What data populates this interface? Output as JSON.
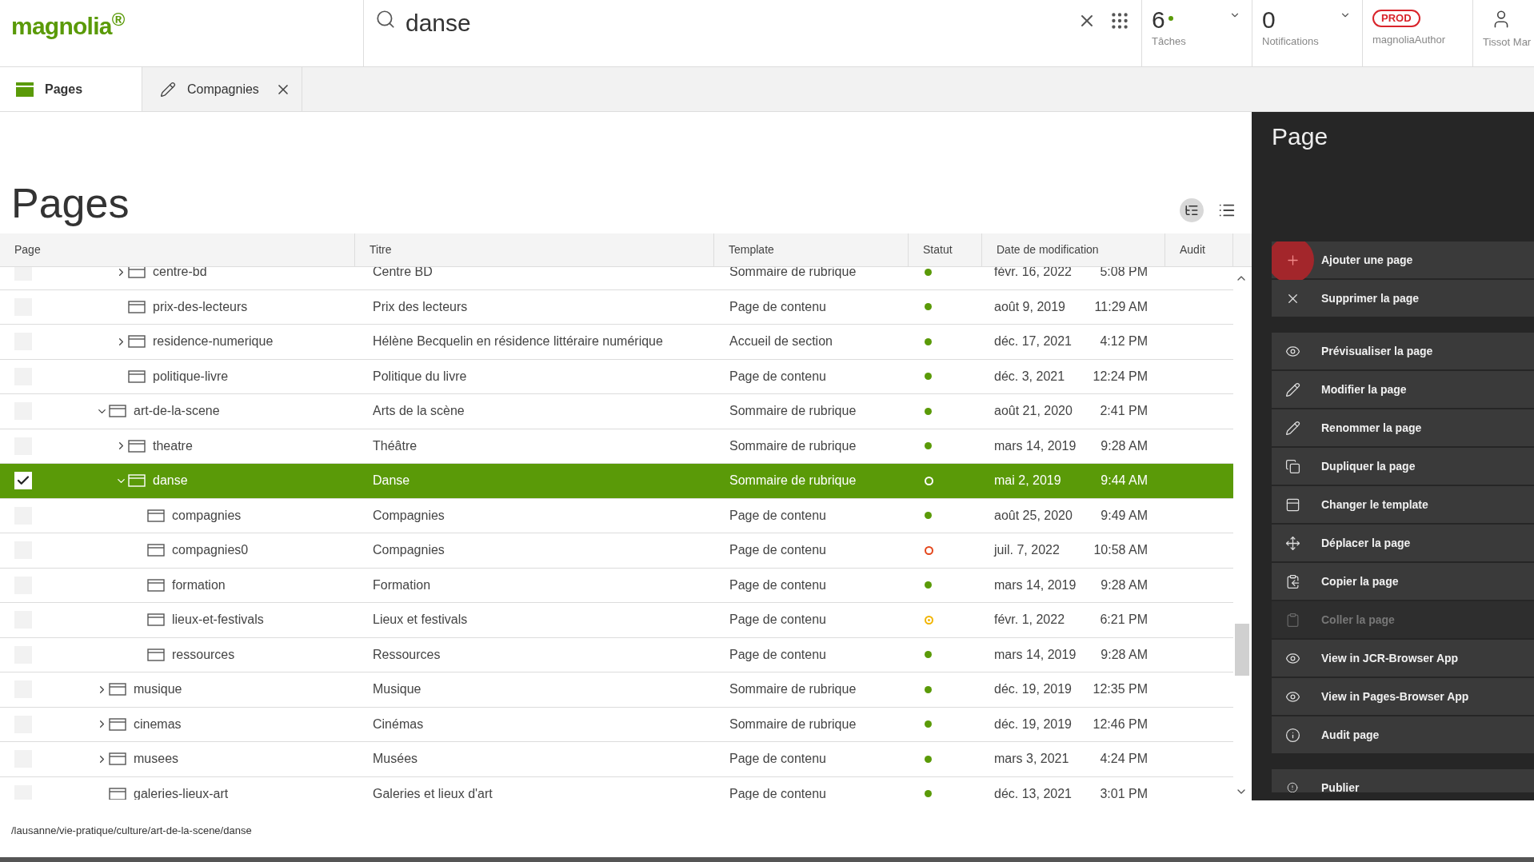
{
  "header": {
    "logo": "magnolia$^{®}$",
    "search": {
      "value": "danse"
    },
    "tasks": {
      "count": "6",
      "label": "Tâches"
    },
    "notifications": {
      "count": "0",
      "label": "Notifications"
    },
    "environment": {
      "badge": "PROD",
      "user_role": "magnoliaAuthor"
    },
    "user": {
      "name": "Tissot Mar"
    }
  },
  "tabs": [
    {
      "label": "Pages",
      "kind": "app",
      "selected": true
    },
    {
      "label": "Compagnies",
      "kind": "editor",
      "selected": false
    }
  ],
  "title": "Pages",
  "table": {
    "columns": [
      "Page",
      "Titre",
      "Template",
      "Statut",
      "Date de modification",
      "Audit"
    ],
    "rows": [
      {
        "children": [
          {
            "page": "centre-bd",
            "title": "Centre BD",
            "template": "Sommaire de rubrique",
            "status": {
              "kind": "dot",
              "color": "#5a9a08"
            },
            "date": "févr. 16, 2022",
            "time": "5:08 PM",
            "expanded": false,
            "selected": false
          },
          {
            "page": "prix-des-lecteurs",
            "title": "Prix des lecteurs",
            "template": "Page de contenu",
            "status": {
              "kind": "dot",
              "color": "#5a9a08"
            },
            "date": "août 9, 2019",
            "time": "11:29 AM",
            "selected": false
          },
          {
            "page": "residence-numerique",
            "title": "Hélène Becquelin en résidence littéraire numérique",
            "template": "Accueil de section",
            "status": {
              "kind": "dot",
              "color": "#5a9a08"
            },
            "date": "déc. 17, 2021",
            "time": "4:12 PM",
            "expanded": false,
            "selected": false
          },
          {
            "page": "politique-livre",
            "title": "Politique du livre",
            "template": "Page de contenu",
            "status": {
              "kind": "dot",
              "color": "#5a9a08"
            },
            "date": "déc. 3, 2021",
            "time": "12:24 PM",
            "selected": false
          }
        ]
      },
      {
        "page": "art-de-la-scene",
        "title": "Arts de la scène",
        "template": "Sommaire de rubrique",
        "status": {
          "kind": "dot",
          "color": "#5a9a08"
        },
        "date": "août 21, 2020",
        "time": "2:41 PM",
        "expanded": true,
        "selected": false,
        "children": [
          {
            "page": "theatre",
            "title": "Théâtre",
            "template": "Sommaire de rubrique",
            "status": {
              "kind": "dot",
              "color": "#5a9a08"
            },
            "date": "mars 14, 2019",
            "time": "9:28 AM",
            "expanded": false,
            "selected": false
          },
          {
            "page": "danse",
            "title": "Danse",
            "template": "Sommaire de rubrique",
            "status": {
              "kind": "ring",
              "color": "#ffffff"
            },
            "date": "mai 2, 2019",
            "time": "9:44 AM",
            "expanded": true,
            "selected": true,
            "children": [
              {
                "page": "compagnies",
                "title": "Compagnies",
                "template": "Page de contenu",
                "status": {
                  "kind": "dot",
                  "color": "#5a9a08"
                },
                "date": "août 25, 2020",
                "time": "9:49 AM",
                "selected": false
              },
              {
                "page": "compagnies0",
                "title": "Compagnies",
                "template": "Page de contenu",
                "status": {
                  "kind": "ring",
                  "color": "#e4461b"
                },
                "date": "juil. 7, 2022",
                "time": "10:58 AM",
                "selected": false
              },
              {
                "page": "formation",
                "title": "Formation",
                "template": "Page de contenu",
                "status": {
                  "kind": "dot",
                  "color": "#5a9a08"
                },
                "date": "mars 14, 2019",
                "time": "9:28 AM",
                "selected": false
              },
              {
                "page": "lieux-et-festivals",
                "title": "Lieux et festivals",
                "template": "Page de contenu",
                "status": {
                  "kind": "ring-dot",
                  "color": "#f2b500"
                },
                "date": "févr. 1, 2022",
                "time": "6:21 PM",
                "selected": false
              },
              {
                "page": "ressources",
                "title": "Ressources",
                "template": "Page de contenu",
                "status": {
                  "kind": "dot",
                  "color": "#5a9a08"
                },
                "date": "mars 14, 2019",
                "time": "9:28 AM",
                "selected": false
              }
            ]
          }
        ]
      },
      {
        "page": "musique",
        "title": "Musique",
        "template": "Sommaire de rubrique",
        "status": {
          "kind": "dot",
          "color": "#5a9a08"
        },
        "date": "déc. 19, 2019",
        "time": "12:35 PM",
        "expanded": false,
        "selected": false
      },
      {
        "page": "cinemas",
        "title": "Cinémas",
        "template": "Sommaire de rubrique",
        "status": {
          "kind": "dot",
          "color": "#5a9a08"
        },
        "date": "déc. 19, 2019",
        "time": "12:46 PM",
        "expanded": false,
        "selected": false
      },
      {
        "page": "musees",
        "title": "Musées",
        "template": "Page de contenu",
        "status": {
          "kind": "dot",
          "color": "#5a9a08"
        },
        "date": "mars 3, 2021",
        "time": "4:24 PM",
        "expanded": false,
        "selected": false
      },
      {
        "page": "galeries-lieux-art",
        "title": "Galeries et lieux d'art",
        "template": "Page de contenu",
        "status": {
          "kind": "dot",
          "color": "#5a9a08"
        },
        "date": "déc. 13, 2021",
        "time": "3:01 PM",
        "selected": false
      }
    ]
  },
  "action_bar": {
    "title": "Page",
    "groups": [
      [
        {
          "label": "Ajouter une page",
          "kind": "add",
          "disabled": false
        },
        {
          "label": "Supprimer la page",
          "kind": "delete",
          "disabled": false
        }
      ],
      [
        {
          "label": "Prévisualiser la page",
          "kind": "preview",
          "disabled": false
        },
        {
          "label": "Modifier la page",
          "kind": "edit",
          "disabled": false
        },
        {
          "label": "Renommer la page",
          "kind": "edit",
          "disabled": false
        },
        {
          "label": "Dupliquer la page",
          "kind": "duplicate",
          "disabled": false
        },
        {
          "label": "Changer le template",
          "kind": "template",
          "disabled": false
        },
        {
          "label": "Déplacer la page",
          "kind": "move",
          "disabled": false
        },
        {
          "label": "Copier la page",
          "kind": "copy",
          "disabled": false
        },
        {
          "label": "Coller la page",
          "kind": "paste",
          "disabled": true
        },
        {
          "label": "View in JCR-Browser App",
          "kind": "preview",
          "disabled": false
        },
        {
          "label": "View in Pages-Browser App",
          "kind": "preview",
          "disabled": false
        },
        {
          "label": "Audit page",
          "kind": "info",
          "disabled": false
        }
      ],
      [
        {
          "label": "Publier",
          "kind": "publish",
          "disabled": false
        }
      ]
    ]
  },
  "status_bar": {
    "path": "/lausanne/vie-pratique/culture/art-de-la-scene/danse"
  }
}
